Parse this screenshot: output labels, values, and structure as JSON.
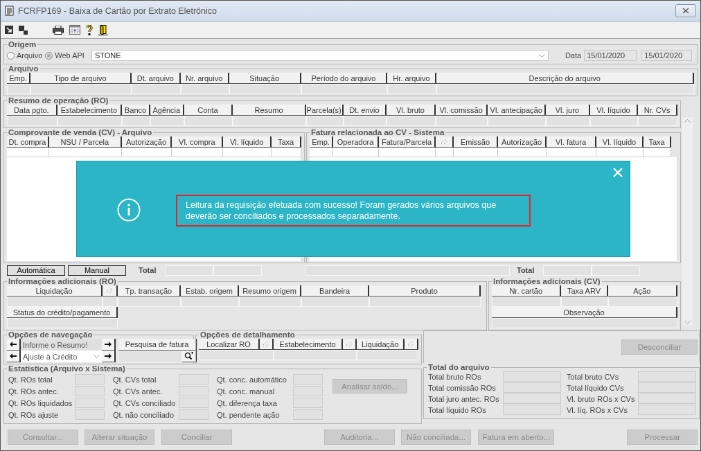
{
  "window": {
    "title": "FCRFP169 - Baixa de Cartão por Extrato Eletrônico"
  },
  "origem": {
    "legend": "Origem",
    "options": [
      {
        "label": "Arquivo",
        "selected": false
      },
      {
        "label": "Web API",
        "selected": true
      }
    ],
    "source": "STONE",
    "date_label": "Data",
    "date_from": "15/01/2020",
    "date_to": "15/01/2020"
  },
  "arquivo": {
    "legend": "Arquivo",
    "columns": [
      {
        "kind": "text",
        "label": "Emp."
      },
      {
        "kind": "text",
        "label": "Tipo de arquivo"
      },
      {
        "kind": "text",
        "label": "Dt. arquivo"
      },
      {
        "kind": "text",
        "label": "Nr. arquivo"
      },
      {
        "kind": "text",
        "label": "Situação"
      },
      {
        "kind": "text",
        "label": "Período do arquivo"
      },
      {
        "kind": "text",
        "label": "Hr. arquivo"
      },
      {
        "kind": "text",
        "label": "Descrição do arquivo"
      }
    ]
  },
  "resumo_ro": {
    "legend": "Resumo de operação (RO)",
    "columns": [
      {
        "kind": "text",
        "label": "Data pgto."
      },
      {
        "kind": "text",
        "label": "Estabelecimento"
      },
      {
        "kind": "text",
        "label": "Banco"
      },
      {
        "kind": "text",
        "label": "Agência"
      },
      {
        "kind": "text",
        "label": "Conta"
      },
      {
        "kind": "text",
        "label": "Resumo"
      },
      {
        "kind": "text",
        "label": "Parcela(s)"
      },
      {
        "kind": "text",
        "label": "Dt. envio"
      },
      {
        "kind": "text",
        "label": "Vl. bruto"
      },
      {
        "kind": "text",
        "label": "Vl. comissão"
      },
      {
        "kind": "text",
        "label": "Vl. antecipação"
      },
      {
        "kind": "text",
        "label": "Vl. juro"
      },
      {
        "kind": "text",
        "label": "Vl. líquido"
      },
      {
        "kind": "text",
        "label": "Nr. CVs"
      }
    ]
  },
  "cv_arquivo": {
    "legend": "Comprovante de venda (CV) - Arquivo",
    "columns": [
      {
        "kind": "text",
        "label": "Dt. compra"
      },
      {
        "kind": "text",
        "label": "NSU / Parcela"
      },
      {
        "kind": "text",
        "label": "Autorização"
      },
      {
        "kind": "text",
        "label": "Vl. compra"
      },
      {
        "kind": "text",
        "label": "Vl. líquido"
      },
      {
        "kind": "text",
        "label": "Taxa"
      }
    ],
    "buttons": [
      {
        "label": "Automática"
      },
      {
        "label": "Manual"
      }
    ],
    "total_label": "Total"
  },
  "fatura_sistema": {
    "legend": "Fatura relacionada ao CV - Sistema",
    "columns": [
      {
        "kind": "text",
        "label": "Emp."
      },
      {
        "kind": "text",
        "label": "Operadora"
      },
      {
        "kind": "text",
        "label": "Fatura/Parcela"
      },
      {
        "kind": "sort"
      },
      {
        "kind": "text",
        "label": "Emissão"
      },
      {
        "kind": "text",
        "label": "Autorização"
      },
      {
        "kind": "text",
        "label": "Vl. fatura"
      },
      {
        "kind": "text",
        "label": "Vl. líquido"
      },
      {
        "kind": "text",
        "label": "Taxa"
      }
    ],
    "total_label": "Total"
  },
  "info_ro": {
    "legend": "Informações adicionais (RO)",
    "columns": [
      {
        "kind": "text",
        "label": "Liquidação"
      },
      {
        "kind": "sort"
      },
      {
        "kind": "text",
        "label": "Tp. transação"
      },
      {
        "kind": "text",
        "label": "Estab. origem"
      },
      {
        "kind": "text",
        "label": "Resumo origem"
      },
      {
        "kind": "text",
        "label": "Bandeira"
      },
      {
        "kind": "text",
        "label": "Produto"
      }
    ],
    "columns_2": [
      {
        "kind": "text",
        "label": "Status do crédito/pagamento"
      }
    ]
  },
  "info_cv": {
    "legend": "Informações adicionais (CV)",
    "columns": [
      {
        "kind": "text",
        "label": "Nr. cartão"
      },
      {
        "kind": "text",
        "label": "Taxa ARV"
      },
      {
        "kind": "text",
        "label": "Ação"
      }
    ],
    "columns_2": [
      {
        "kind": "text",
        "label": "Observação"
      }
    ]
  },
  "navegacao": {
    "legend": "Opções de navegação",
    "resumo": "Informe o Resumo!",
    "ajuste": "Ajuste à Crédito",
    "pesquisa": "Pesquisa de fatura"
  },
  "detalhamento": {
    "legend": "Opções de detalhamento",
    "columns": [
      {
        "kind": "text",
        "label": "Localizar RO"
      },
      {
        "kind": "sort"
      },
      {
        "kind": "text",
        "label": "Estabelecimento"
      },
      {
        "kind": "sort"
      },
      {
        "kind": "text",
        "label": "Liquidação"
      },
      {
        "kind": "sort"
      }
    ]
  },
  "desconciliar": {
    "label": "Desconciliar",
    "disabled": true
  },
  "estatistica": {
    "legend": "Estatística (Arquivo x Sistema)",
    "groups": [
      [
        "Qt. ROs total",
        "Qt. ROs antec.",
        "Qt. ROs liquidados",
        "Qt. ROs ajuste"
      ],
      [
        "Qt. CVs total",
        "Qt. CVs antec.",
        "Qt. CVs conciliado",
        "Qt. não conciliado"
      ],
      [
        "Qt. conc. automático",
        "Qt. conc. manual",
        "Qt. diferença taxa",
        "Qt. pendente ação"
      ]
    ],
    "analisar": {
      "label": "Analisar saldo...",
      "disabled": true
    }
  },
  "total_arquivo": {
    "legend": "Total do arquivo",
    "groups": [
      [
        "Total bruto ROs",
        "Total comissão ROs",
        "Total juro antec. ROs",
        "Total líquido ROs"
      ],
      [
        "Total bruto CVs",
        "Total líquido CVs",
        "Vl. bruto ROs x CVs",
        "Vl. líq. ROs x CVs"
      ]
    ]
  },
  "actions": [
    {
      "label": "Consultar...",
      "disabled": true
    },
    {
      "label": "Alterar situação",
      "disabled": true
    },
    {
      "label": "Conciliar",
      "disabled": true
    },
    {
      "label": "Auditoria...",
      "disabled": true
    },
    {
      "label": "Não conciliada...",
      "disabled": true
    },
    {
      "label": "Fatura em aberto...",
      "disabled": true
    },
    {
      "label": "Processar",
      "disabled": true
    }
  ],
  "dialog": {
    "message": "Leitura da requisição efetuada com sucesso! Foram gerados vários arquivos que deverão ser conciliados e processados separadamente."
  }
}
